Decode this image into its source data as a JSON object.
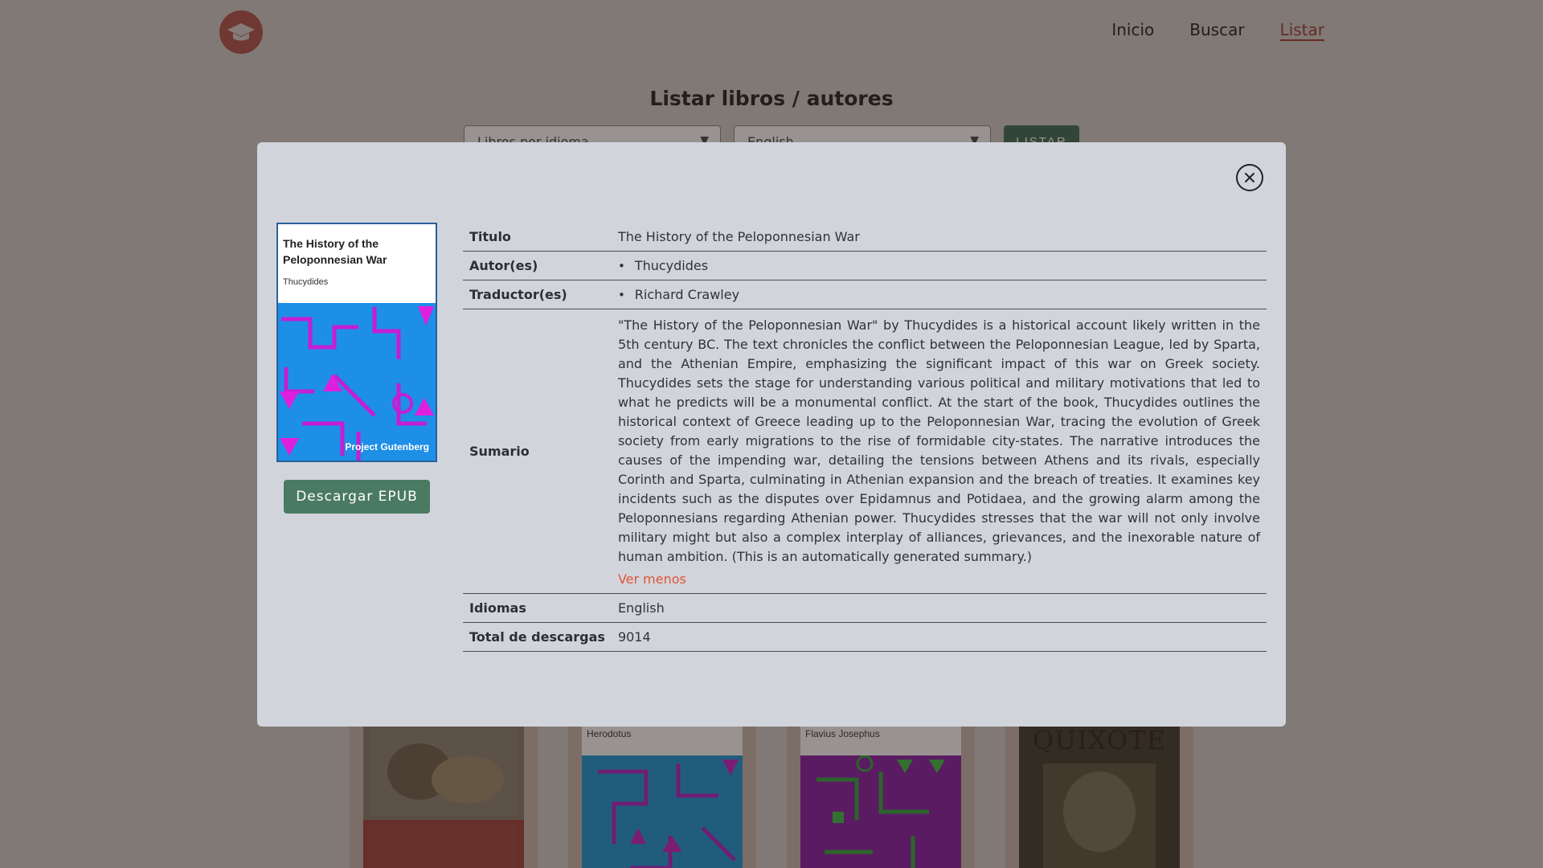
{
  "nav": {
    "items": [
      {
        "label": "Inicio",
        "active": false
      },
      {
        "label": "Buscar",
        "active": false
      },
      {
        "label": "Listar",
        "active": true
      }
    ]
  },
  "list_page": {
    "title": "Listar libros / autores",
    "filter_type": "Libros por idioma",
    "filter_language": "English",
    "list_button": "LISTAR",
    "cards": [
      {
        "author": ""
      },
      {
        "author": "Herodotus"
      },
      {
        "author": "Flavius Josephus"
      },
      {
        "title_fragment": "QUIXOTE"
      }
    ]
  },
  "modal": {
    "cover": {
      "title": "The History of the Peloponnesian War",
      "author": "Thucydides",
      "publisher": "Project Gutenberg"
    },
    "download_label": "Descargar EPUB",
    "fields": {
      "titulo_label": "Titulo",
      "titulo": "The History of the Peloponnesian War",
      "autores_label": "Autor(es)",
      "autores": [
        "Thucydides"
      ],
      "traductores_label": "Traductor(es)",
      "traductores": [
        "Richard Crawley"
      ],
      "sumario_label": "Sumario",
      "sumario": "\"The History of the Peloponnesian War\" by Thucydides is a historical account likely written in the 5th century BC. The text chronicles the conflict between the Peloponnesian League, led by Sparta, and the Athenian Empire, emphasizing the significant impact of this war on Greek society. Thucydides sets the stage for understanding various political and military motivations that led to what he predicts will be a monumental conflict. At the start of the book, Thucydides outlines the historical context of Greece leading up to the Peloponnesian War, tracing the evolution of Greek society from early migrations to the rise of formidable city-states. The narrative introduces the causes of the impending war, detailing the tensions between Athens and its rivals, especially Corinth and Sparta, culminating in Athenian expansion and the breach of treaties. It examines key incidents such as the disputes over Epidamnus and Potidaea, and the growing alarm among the Peloponnesians regarding Athenian power. Thucydides stresses that the war will not only involve military might but also a complex interplay of alliances, grievances, and the inexorable nature of human ambition. (This is an automatically generated summary.)",
      "toggle_label": "Ver menos",
      "idiomas_label": "Idiomas",
      "idiomas": "English",
      "descargas_label": "Total de descargas",
      "descargas": "9014"
    }
  },
  "colors": {
    "accent_nav": "#9b3a2f",
    "logo": "#b0524a",
    "download_button": "#4a7a62",
    "toggle_link": "#e0543a",
    "modal_bg": "#d1d5db"
  },
  "icons": {
    "logo": "graduation-cap-icon",
    "close": "close-icon",
    "select_caret": "caret-down-icon"
  }
}
